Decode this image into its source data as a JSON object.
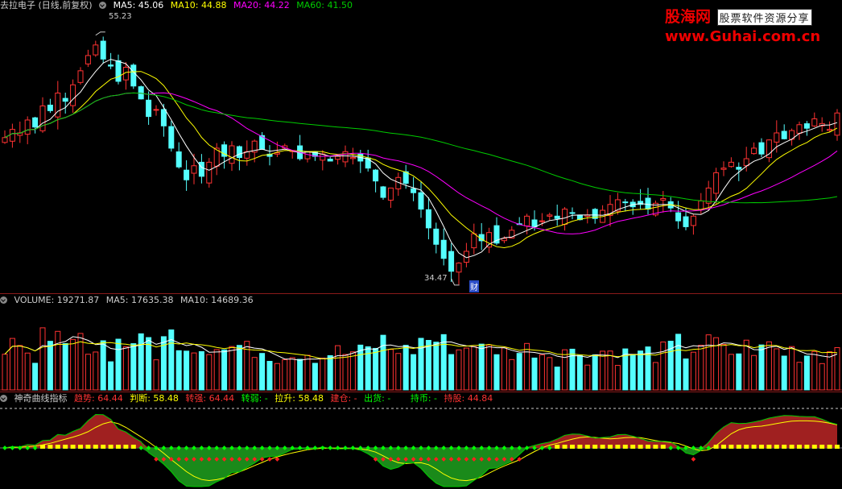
{
  "main": {
    "title": "去拉电子 (日线,前复权)",
    "ma5": "MA5: 45.06",
    "ma10": "MA10: 44.88",
    "ma20": "MA20: 44.22",
    "ma60": "MA60: 41.50",
    "high_label": "55.23",
    "low_label": "34.47",
    "cai_label": "财"
  },
  "volume": {
    "title": "VOLUME: 19271.87",
    "ma5": "MA5: 17635.38",
    "ma10": "MA10: 14689.36"
  },
  "indicator": {
    "title": "神奇曲线指标",
    "qushi": "趋势: 64.44",
    "panduan": "判断: 58.48",
    "zhuanqiang": "转强: 64.44",
    "zhuanruo": "转弱: -",
    "lasheng": "拉升: 58.48",
    "jiancang": "建仓: -",
    "chuhuo": "出货: -",
    "chibi": "持币: -",
    "chigu": "持股: 44.84"
  },
  "logo": {
    "name": "股海网",
    "tagline": "股票软件资源分享",
    "url": "www.Guhai.com.cn"
  },
  "colors": {
    "up": "#ff3232",
    "down": "#54ffff",
    "ma5": "#ffffff",
    "ma10": "#ffff00",
    "ma20": "#ff00ff",
    "ma60": "#00cc00"
  },
  "chart_data": {
    "type": "candlestick",
    "price_range": [
      33.5,
      57
    ],
    "key_points": {
      "high": 55.23,
      "low": 34.47
    },
    "closes": [
      46.5,
      47.2,
      46.9,
      48,
      47.4,
      49.2,
      48.8,
      50.3,
      49.6,
      51,
      52.2,
      53.5,
      54.4,
      53.2,
      52.6,
      51.3,
      52.5,
      50.9,
      49.8,
      48.3,
      48.9,
      47.5,
      45.6,
      44,
      42.9,
      44.1,
      43.2,
      44.4,
      45.6,
      44.9,
      45.8,
      44.8,
      45.3,
      46.2,
      45.5,
      44.9,
      45.2,
      45.8,
      45.4,
      44.7,
      45.3,
      44.9,
      45.1,
      44.5,
      44.9,
      45.3,
      44.8,
      44.5,
      43.9,
      42.8,
      41.4,
      42.2,
      43.1,
      42.6,
      41.8,
      40.4,
      38.8,
      37.4,
      36.2,
      35.1,
      35.8,
      36.8,
      38.3,
      37.7,
      38.4,
      37.5,
      37.9,
      38.6,
      39.1,
      39.8,
      38.9,
      39.4,
      39.9,
      39.6,
      40.4,
      40.1,
      39.5,
      39.9,
      39.6,
      40.3,
      40.8,
      41.2,
      41,
      40.6,
      40.8,
      40.4,
      40.9,
      41.3,
      40.5,
      39.4,
      38.9,
      39.8,
      41.1,
      42.2,
      43.5,
      43.9,
      44.4,
      43.8,
      44.7,
      45.6,
      45.1,
      46.3,
      46.9,
      46.4,
      47.1,
      47.6,
      47.3,
      48.1,
      47.7,
      47.2,
      48.6
    ],
    "volume_range": [
      0,
      30000
    ],
    "volume_ma": {
      "ma5": 17635.38,
      "ma10": 14689.36
    }
  }
}
